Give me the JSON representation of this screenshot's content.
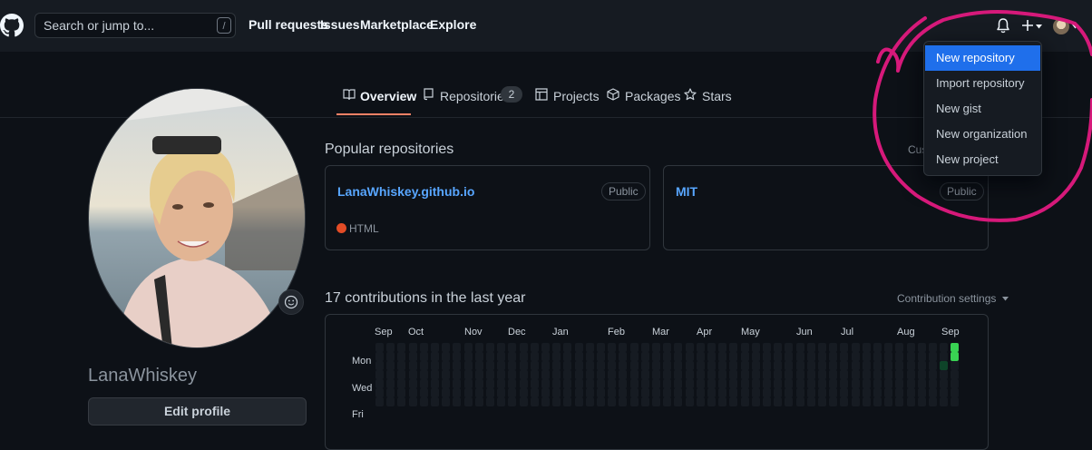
{
  "header": {
    "search_placeholder": "Search or jump to...",
    "search_shortcut": "/",
    "nav": [
      "Pull requests",
      "Issues",
      "Marketplace",
      "Explore"
    ]
  },
  "tabs": [
    {
      "label": "Overview",
      "icon": "book-icon",
      "active": true
    },
    {
      "label": "Repositories",
      "icon": "repo-icon",
      "count": "2"
    },
    {
      "label": "Projects",
      "icon": "table-icon"
    },
    {
      "label": "Packages",
      "icon": "package-icon"
    },
    {
      "label": "Stars",
      "icon": "star-icon"
    }
  ],
  "profile": {
    "username": "LanaWhiskey",
    "edit_button": "Edit profile"
  },
  "popular": {
    "title": "Popular repositories",
    "customize": "Cus",
    "repos": [
      {
        "name": "LanaWhiskey.github.io",
        "visibility": "Public",
        "language": "HTML",
        "language_color": "#e34c26"
      },
      {
        "name": "MIT",
        "visibility": "Public"
      }
    ]
  },
  "contributions": {
    "title": "17 contributions in the last year",
    "settings": "Contribution settings",
    "months": [
      "Sep",
      "Oct",
      "Nov",
      "Dec",
      "Jan",
      "Feb",
      "Mar",
      "Apr",
      "May",
      "Jun",
      "Jul",
      "Aug",
      "Sep"
    ],
    "days": [
      "Mon",
      "Wed",
      "Fri"
    ],
    "colors": {
      "empty": "#161b22",
      "level1": "#0e4429",
      "level3": "#26a641",
      "level4": "#39d353"
    }
  },
  "dropdown": {
    "items": [
      "New repository",
      "Import repository",
      "New gist",
      "New organization",
      "New project"
    ],
    "selected": 0
  },
  "colors": {
    "accent": "#f78166",
    "link": "#58a6ff",
    "annotation": "#d6197a"
  }
}
